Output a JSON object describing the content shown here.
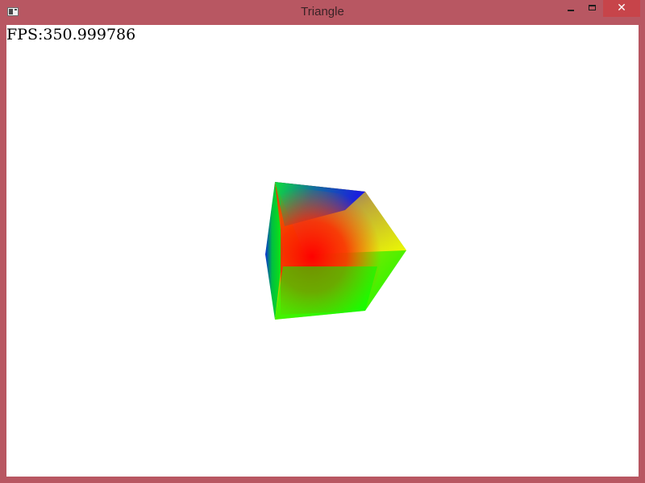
{
  "window": {
    "title": "Triangle",
    "close_glyph": "✕",
    "frame_color": "#b85762",
    "close_color": "#c7444a"
  },
  "icons": {
    "app": "app-window-icon",
    "minimize": "minimize-icon",
    "maximize": "maximize-icon",
    "close": "close-icon"
  },
  "canvas": {
    "fps_text": "FPS:350.999786",
    "background": "#ffffff",
    "object": "rotating-colored-cube",
    "face_colors": [
      "#ff0000",
      "#00ff00",
      "#0000ff",
      "#ffff00"
    ]
  }
}
